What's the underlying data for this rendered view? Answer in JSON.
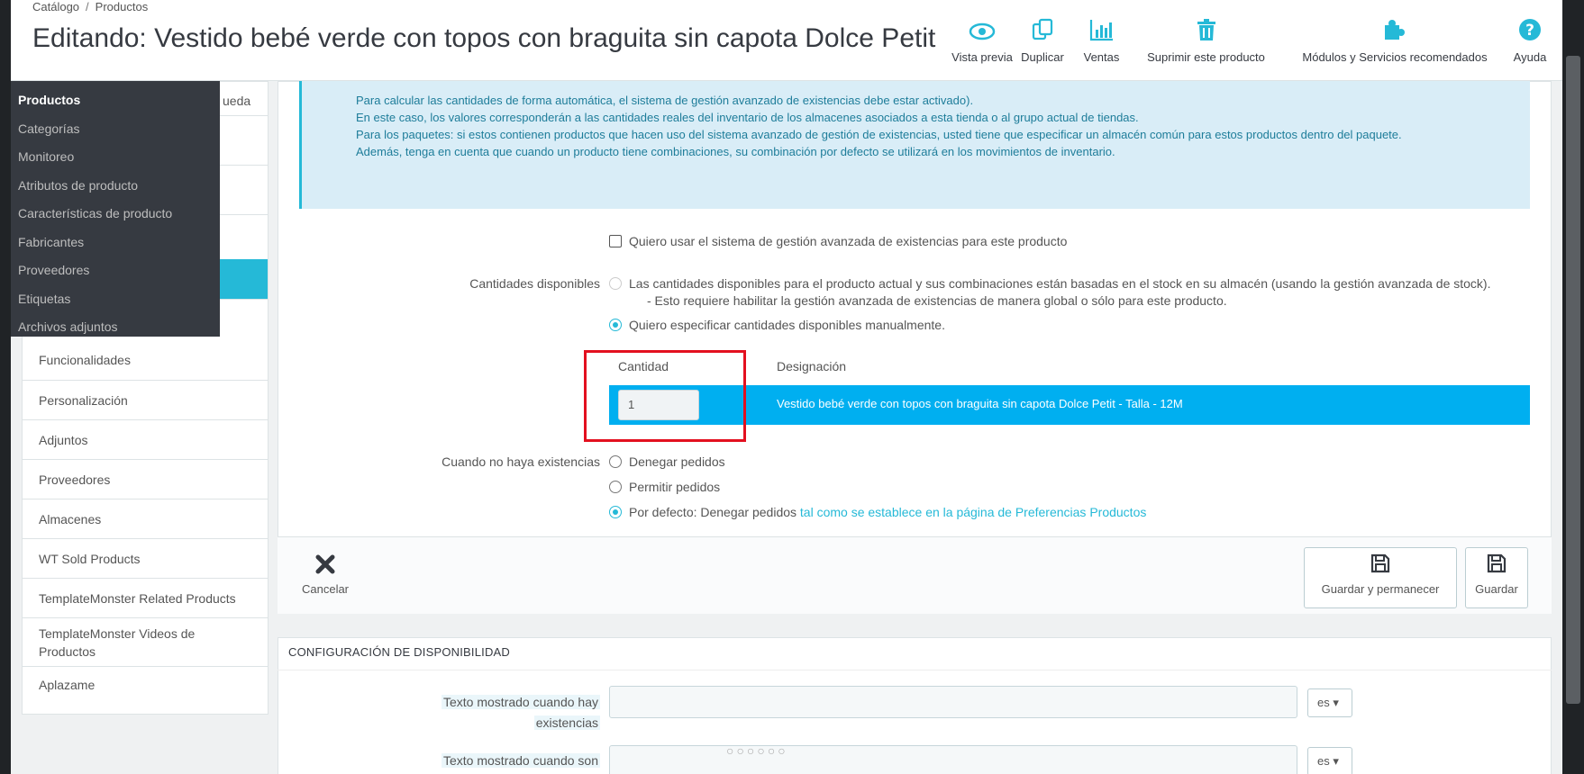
{
  "breadcrumb": {
    "first": "Catálogo",
    "separator": "/",
    "second": "Productos"
  },
  "page_title": "Editando: Vestido bebé verde con topos con braguita sin capota Dolce Petit",
  "toolbar": [
    {
      "label": "Vista previa",
      "icon": "eye-icon"
    },
    {
      "label": "Duplicar",
      "icon": "copy-icon"
    },
    {
      "label": "Ventas",
      "icon": "bar-chart-icon"
    },
    {
      "label": "Suprimir este producto",
      "icon": "trash-icon"
    },
    {
      "label": "Módulos y Servicios recomendados",
      "icon": "puzzle-icon"
    },
    {
      "label": "Ayuda",
      "icon": "help-icon"
    }
  ],
  "main_menu": [
    "Productos",
    "Categorías",
    "Monitoreo",
    "Atributos de producto",
    "Características de producto",
    "Fabricantes",
    "Proveedores",
    "Etiquetas",
    "Archivos adjuntos"
  ],
  "sidebar_tab_peek": "ueda",
  "sidebar_tabs": [
    "Funcionalidades",
    "Personalización",
    "Adjuntos",
    "Proveedores",
    "Almacenes",
    "WT Sold Products",
    "TemplateMonster Related Products",
    "TemplateMonster Videos de Productos",
    "Aplazame"
  ],
  "info_lines": [
    "Para calcular las cantidades de forma automática, el sistema de gestión avanzado de existencias debe estar activado).",
    "En este caso, los valores corresponderán a las cantidades reales del inventario de los almacenes asociados a esta tienda o al grupo actual de tiendas.",
    "Para los paquetes: si estos contienen productos que hacen uso del sistema avanzado de gestión de existencias, usted tiene que especificar un almacén común para estos productos dentro del paquete.",
    "Además, tenga en cuenta que cuando un producto tiene combinaciones, su combinación por defecto se utilizará en los movimientos de inventario."
  ],
  "advanced_stock_checkbox": "Quiero usar el sistema de gestión avanzada de existencias para este producto",
  "quantities": {
    "label": "Cantidades disponibles",
    "option_auto": "Las cantidades disponibles para el producto actual y sus combinaciones están basadas en el stock en su almacén (usando la gestión avanzada de stock).",
    "option_auto_note": "- Esto requiere habilitar la gestión avanzada de existencias de manera global o sólo para este producto.",
    "option_manual": "Quiero especificar cantidades disponibles manualmente.",
    "col_quantity": "Cantidad",
    "col_designation": "Designación",
    "row_value": "1",
    "row_designation": "Vestido bebé verde con topos con braguita sin capota Dolce Petit - Talla - 12M"
  },
  "out_of_stock": {
    "label": "Cuando no haya existencias",
    "deny": "Denegar pedidos",
    "allow": "Permitir pedidos",
    "default_prefix": "Por defecto: Denegar pedidos",
    "default_link": "tal como se establece en la página de Preferencias Productos"
  },
  "footer": {
    "cancel": "Cancelar",
    "save_stay": "Guardar y permanecer",
    "save": "Guardar"
  },
  "availability": {
    "title": "CONFIGURACIÓN DE DISPONIBILIDAD",
    "label_in_stock_1": "Texto mostrado cuando hay",
    "label_in_stock_2": "existencias",
    "label_backorder_1": "Texto mostrado cuando son",
    "lang": "es"
  },
  "colors": {
    "accent": "#25b9d7",
    "row_highlight": "#00aff0",
    "annotation": "#e3101f",
    "menu_bg": "#363a41"
  }
}
